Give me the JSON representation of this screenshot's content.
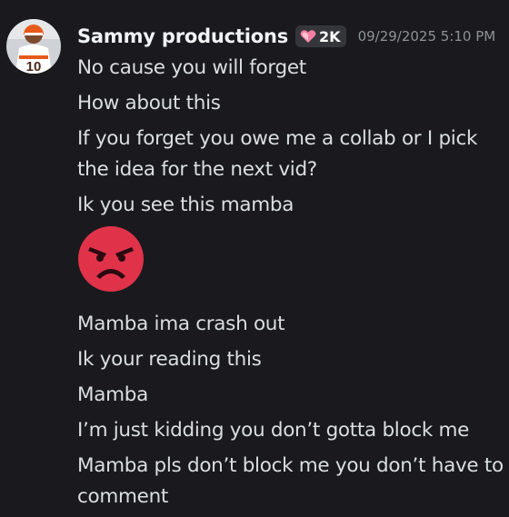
{
  "message": {
    "author": "Sammy productions",
    "badge": {
      "icon": "heart-gem-icon",
      "count": "2K"
    },
    "timestamp": "09/29/2025 5:10 PM",
    "lines": [
      "No cause you will forget",
      "How about this",
      "If you forget you owe me a collab or I pick the idea for the next vid?",
      "Ik you see this mamba",
      "",
      "Mamba ima crash out",
      "Ik your reading this",
      "Mamba",
      "I’m just kidding you don’t gotta block me",
      "Mamba pls don’t block me you don’t have to comment"
    ],
    "emoji": "angry-face-emoji"
  },
  "colors": {
    "background": "#1a1a1e",
    "username": "#f2f3f5",
    "text": "#dbdee1",
    "timestamp": "#8e9297",
    "badge_bg": "#35363c",
    "emoji_red": "#e0334a"
  }
}
